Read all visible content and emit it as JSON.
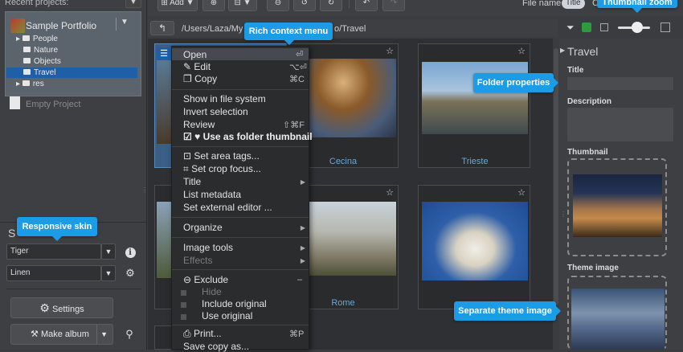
{
  "left_panel": {
    "recent_label": "Recent projects:",
    "recent_dropdown": "▼",
    "project_name": "Sample Portfolio",
    "project_dropdown": "▼",
    "tree": [
      {
        "label": "People",
        "expander": "▸"
      },
      {
        "label": "Nature",
        "expander": ""
      },
      {
        "label": "Objects",
        "expander": ""
      },
      {
        "label": "Travel",
        "expander": "",
        "selected": true
      },
      {
        "label": "res",
        "expander": "▸"
      }
    ],
    "empty_project": "Empty Project",
    "skin_label_partial": "S",
    "skin_select": "Tiger",
    "style_select": "Linen",
    "info_icon": "i",
    "settings_label": "Settings",
    "make_album_label": "Make album"
  },
  "toolbar": {
    "add_label": "Add",
    "file_name_label": "File name",
    "title_pill": "Title",
    "c_letter": "C"
  },
  "path": {
    "left": "/Users/Laza/My",
    "right": "o/Travel"
  },
  "grid": {
    "captions": [
      "Cecina",
      "Trieste",
      "Rome"
    ]
  },
  "context_menu": {
    "items": [
      {
        "label": "Open",
        "shortcut": "⏎"
      },
      {
        "label": "Edit",
        "shortcut": "⌥⏎"
      },
      {
        "label": "Copy",
        "shortcut": "⌘C"
      },
      {
        "label": "Show in file system"
      },
      {
        "label": "Invert selection"
      },
      {
        "label": "Review",
        "shortcut": "⇧⌘F"
      },
      {
        "label": "Use as folder thumbnail"
      },
      {
        "label": "Set area tags..."
      },
      {
        "label": "Set crop focus..."
      },
      {
        "label": "Title"
      },
      {
        "label": "List metadata"
      },
      {
        "label": "Set external editor ..."
      },
      {
        "label": "Organize"
      },
      {
        "label": "Image tools"
      },
      {
        "label": "Effects"
      },
      {
        "label": "Exclude",
        "shortcut": "–"
      },
      {
        "label": "Hide"
      },
      {
        "label": "Include original"
      },
      {
        "label": "Use original"
      },
      {
        "label": "Print...",
        "shortcut": "⌘P"
      },
      {
        "label": "Save copy as..."
      }
    ]
  },
  "right_panel": {
    "folder_title": "Travel",
    "title_label": "Title",
    "description_label": "Description",
    "thumbnail_label": "Thumbnail",
    "theme_image_label": "Theme image"
  },
  "callouts": {
    "rich_context_menu": "Rich context menu",
    "thumbnail_zoom": "Thumbnail zoom",
    "folder_properties": "Folder properties",
    "responsive_skin": "Responsive skin",
    "separate_theme_image": "Separate theme image"
  },
  "colors": {
    "accent": "#1c9be6",
    "selection": "#1e5fa8",
    "caption": "#6aa7d8"
  }
}
